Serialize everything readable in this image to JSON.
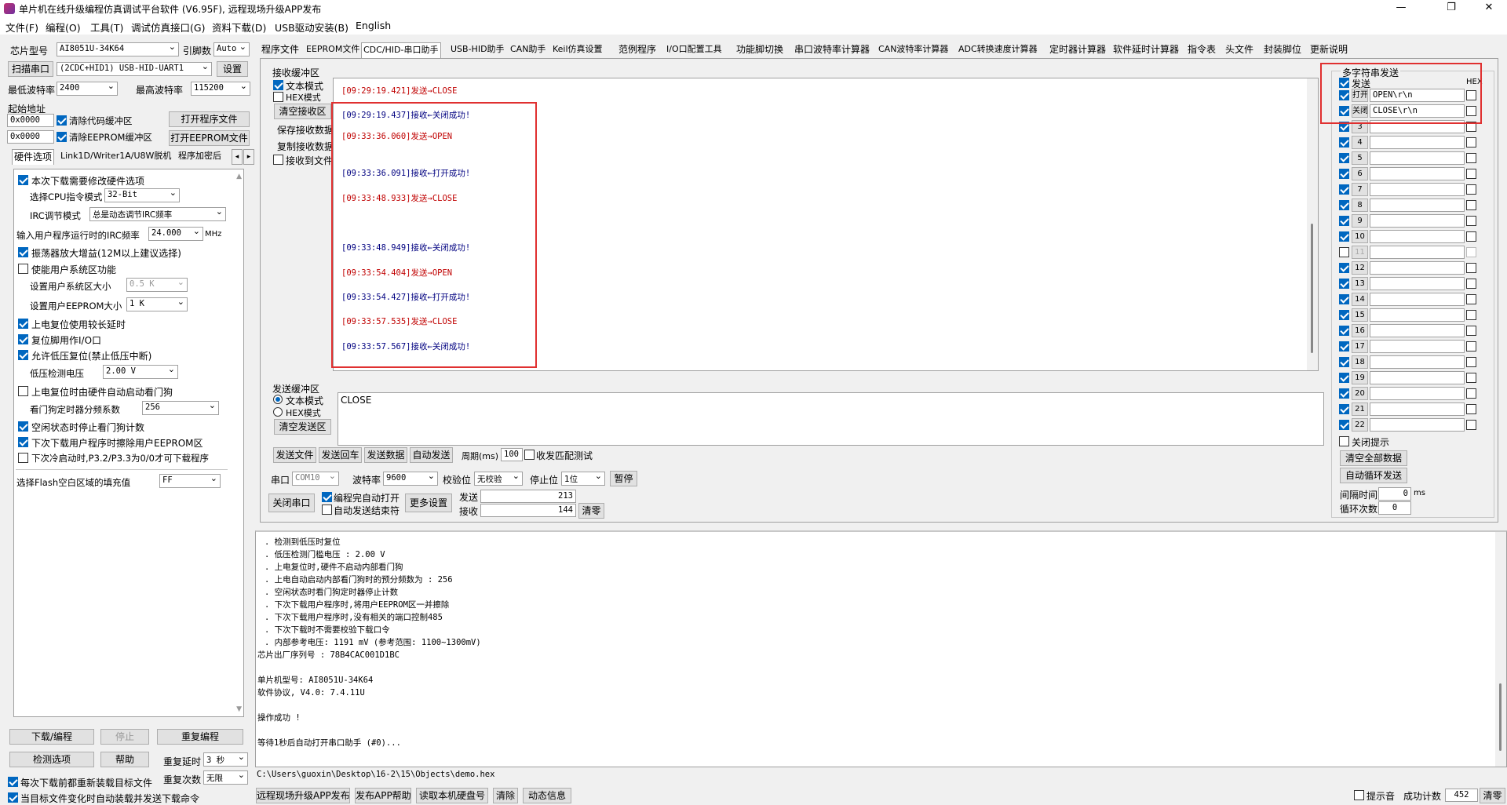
{
  "window": {
    "title": "单片机在线升级编程仿真调试平台软件 (V6.95F), 远程现场升级APP发布",
    "min": "—",
    "max": "❐",
    "close": "✕"
  },
  "menu": [
    "文件(F)",
    "编程(O)",
    "工具(T)",
    "调试仿真接口(G)",
    "资料下载(D)",
    "USB驱动安装(B)",
    "English"
  ],
  "left": {
    "chip_label": "芯片型号",
    "chip_value": "AI8051U-34K64",
    "pin_label": "引脚数",
    "pin_value": "Auto",
    "scan_btn": "扫描串口",
    "port_value": "(2CDC+HID1) USB-HID-UART1",
    "settings_btn": "设置",
    "min_baud_label": "最低波特率",
    "min_baud_value": "2400",
    "max_baud_label": "最高波特率",
    "max_baud_value": "115200",
    "start_addr_label": "起始地址",
    "addr1": "0x0000",
    "clear_code": "清除代码缓冲区",
    "open_prog": "打开程序文件",
    "addr2": "0x0000",
    "clear_eeprom": "清除EEPROM缓冲区",
    "open_eeprom": "打开EEPROM文件",
    "tabs": [
      "硬件选项",
      "Link1D/Writer1A/U8W脱机",
      "程序加密后"
    ],
    "options": {
      "o1": "本次下载需要修改硬件选项",
      "cpu_label": "选择CPU指令模式",
      "cpu_value": "32-Bit",
      "irc_label": "IRC调节模式",
      "irc_value": "总是动态调节IRC频率",
      "freq_label": "输入用户程序运行时的IRC频率",
      "freq_value": "24.000",
      "freq_unit": "MHz",
      "o2": "振荡器放大增益(12M以上建议选择)",
      "o3": "使能用户系统区功能",
      "sys_label": "设置用户系统区大小",
      "sys_value": "0.5 K",
      "eep_label": "设置用户EEPROM大小",
      "eep_value": "1   K",
      "o4": "上电复位使用较长延时",
      "o5": "复位脚用作I/O口",
      "o6": "允许低压复位(禁止低压中断)",
      "lv_label": "低压检测电压",
      "lv_value": "2.00 V",
      "o7": "上电复位时由硬件自动启动看门狗",
      "wdt_label": "看门狗定时器分频系数",
      "wdt_value": "256",
      "o8": "空闲状态时停止看门狗计数",
      "o9": "下次下载用户程序时擦除用户EEPROM区",
      "o10": "下次冷启动时,P3.2/P3.3为0/0才可下载程序",
      "fill_label": "选择Flash空白区域的填充值",
      "fill_value": "FF"
    },
    "download_btn": "下载/编程",
    "stop_btn": "停止",
    "reprog_btn": "重复编程",
    "detect_btn": "检测选项",
    "help_btn": "帮助",
    "delay_label": "重复延时",
    "delay_value": "3 秒",
    "count_label": "重复次数",
    "count_value": "无限",
    "reload": "每次下载前都重新装载目标文件",
    "autoload": "当目标文件变化时自动装载并发送下载命令"
  },
  "tabs": [
    "程序文件",
    "EEPROM文件",
    "CDC/HID-串口助手",
    "USB-HID助手",
    "CAN助手",
    "Keil仿真设置",
    "范例程序",
    "I/O口配置工具",
    "功能脚切换",
    "串口波特率计算器",
    "CAN波特率计算器",
    "ADC转换速度计算器",
    "定时器计算器",
    "软件延时计算器",
    "指令表",
    "头文件",
    "封装脚位",
    "更新说明"
  ],
  "recv": {
    "group": "接收缓冲区",
    "text_mode": "文本模式",
    "hex_mode": "HEX模式",
    "clear": "清空接收区",
    "save": "保存接收数据",
    "copy": "复制接收数据",
    "to_file": "接收到文件",
    "lines": [
      {
        "t": "[09:29:19.421]发送→CLOSE",
        "c": "red"
      },
      {
        "t": "[09:29:19.437]接收←关闭成功!",
        "c": "blue"
      },
      {
        "t": "[09:33:36.060]发送→OPEN",
        "c": "red"
      },
      {
        "t": "[09:33:36.091]接收←打开成功!",
        "c": "blue"
      },
      {
        "t": "[09:33:48.933]发送→CLOSE",
        "c": "red"
      },
      {
        "t": "[09:33:48.949]接收←关闭成功!",
        "c": "blue"
      },
      {
        "t": "[09:33:54.404]发送→OPEN",
        "c": "red"
      },
      {
        "t": "[09:33:54.427]接收←打开成功!",
        "c": "blue"
      },
      {
        "t": "[09:33:57.535]发送→CLOSE",
        "c": "red"
      },
      {
        "t": "[09:33:57.567]接收←关闭成功!",
        "c": "blue"
      }
    ]
  },
  "send": {
    "group": "发送缓冲区",
    "text_mode": "文本模式",
    "hex_mode": "HEX模式",
    "clear": "清空发送区",
    "content": "CLOSE",
    "send_file": "发送文件",
    "send_enter": "发送回车",
    "send_data": "发送数据",
    "auto_send": "自动发送",
    "period_label": "周期(ms)",
    "period_value": "100",
    "match": "收发匹配测试"
  },
  "port": {
    "port_label": "串口",
    "port_value": "COM10",
    "baud_label": "波特率",
    "baud_value": "9600",
    "parity_label": "校验位",
    "parity_value": "无校验",
    "stop_label": "停止位",
    "stop_value": "1位",
    "pause": "暂停",
    "close": "关闭串口",
    "auto_open": "编程完自动打开",
    "auto_end": "自动发送结束符",
    "more": "更多设置",
    "sent_label": "发送",
    "sent_value": "213",
    "recv_label": "接收",
    "recv_value": "144",
    "clear": "清零"
  },
  "multi": {
    "group": "多字符串发送",
    "send_hdr": "发送",
    "hex_hdr": "HEX",
    "rows": [
      {
        "n": "打开",
        "v": "OPEN\\r\\n"
      },
      {
        "n": "关闭",
        "v": "CLOSE\\r\\n"
      },
      {
        "n": "3",
        "v": ""
      },
      {
        "n": "4",
        "v": ""
      },
      {
        "n": "5",
        "v": ""
      },
      {
        "n": "6",
        "v": ""
      },
      {
        "n": "7",
        "v": ""
      },
      {
        "n": "8",
        "v": ""
      },
      {
        "n": "9",
        "v": ""
      },
      {
        "n": "10",
        "v": ""
      },
      {
        "n": "11",
        "v": ""
      },
      {
        "n": "12",
        "v": ""
      },
      {
        "n": "13",
        "v": ""
      },
      {
        "n": "14",
        "v": ""
      },
      {
        "n": "15",
        "v": ""
      },
      {
        "n": "16",
        "v": ""
      },
      {
        "n": "17",
        "v": ""
      },
      {
        "n": "18",
        "v": ""
      },
      {
        "n": "19",
        "v": ""
      },
      {
        "n": "20",
        "v": ""
      },
      {
        "n": "21",
        "v": ""
      },
      {
        "n": "22",
        "v": ""
      }
    ],
    "close_tip": "关闭提示",
    "clear_all": "清空全部数据",
    "auto_loop": "自动循环发送",
    "interval_label": "间隔时间",
    "interval_value": "0",
    "interval_unit": "ms",
    "loop_label": "循环次数",
    "loop_value": "0"
  },
  "log": {
    "lines": [
      ". 检测到低压时复位",
      ". 低压检测门槛电压 : 2.00 V",
      ". 上电复位时,硬件不启动内部看门狗",
      ". 上电自动启动内部看门狗时的预分频数为 : 256",
      ". 空闲状态时看门狗定时器停止计数",
      ". 下次下载用户程序时,将用户EEPROM区一并擦除",
      ". 下次下载用户程序时,没有相关的端口控制485",
      ". 下次下载时不需要校验下载口令",
      ". 内部参考电压: 1191 mV (参考范围: 1100~1300mV)",
      "芯片出厂序列号 : 78B4CAC001D1BC",
      "",
      "  单片机型号: AI8051U-34K64",
      "  软件协议, V4.0: 7.4.11U",
      "",
      "操作成功 !",
      "",
      "等待1秒后自动打开串口助手 (#0)..."
    ]
  },
  "path": "C:\\Users\\guoxin\\Desktop\\16-2\\15\\Objects\\demo.hex",
  "bottom": {
    "b1": "远程现场升级APP发布",
    "b2": "发布APP帮助",
    "b3": "读取本机硬盘号",
    "b4": "清除",
    "b5": "动态信息",
    "sound": "提示音",
    "succ_label": "成功计数",
    "succ_value": "452",
    "clear": "清零"
  }
}
